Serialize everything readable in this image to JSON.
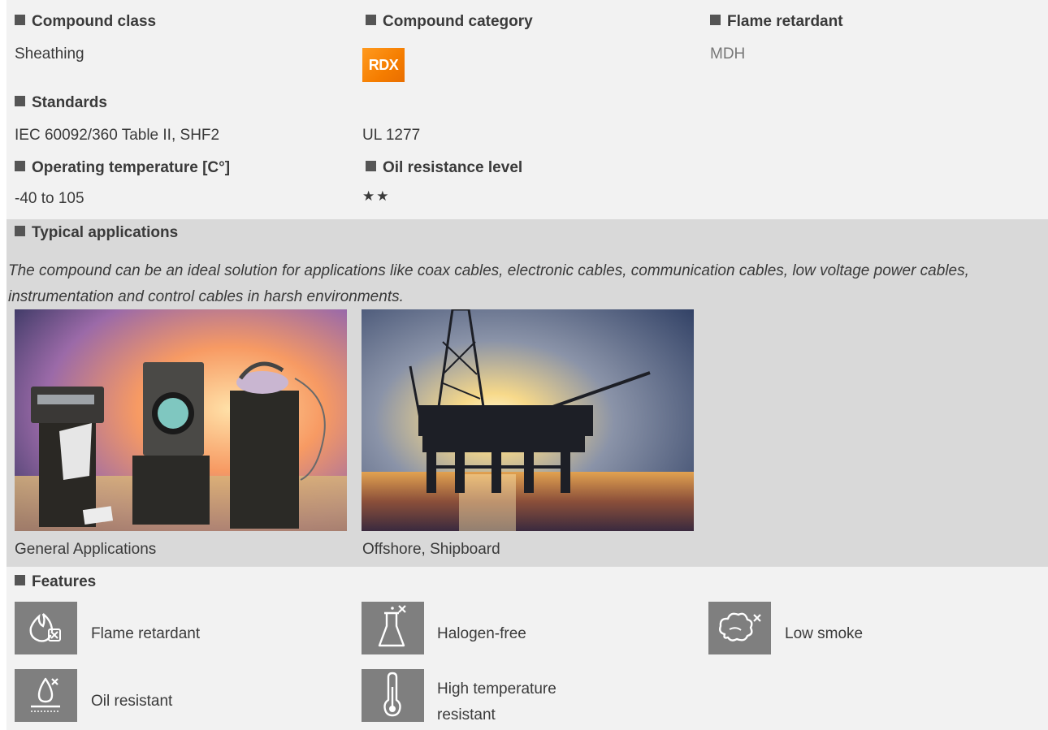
{
  "compound_class": {
    "heading": "Compound class",
    "value": "Sheathing"
  },
  "compound_category": {
    "heading": "Compound category",
    "badge": "RDX",
    "badge_color": "#f58a0a"
  },
  "flame_retardant": {
    "heading": "Flame retardant",
    "value": "MDH"
  },
  "standards": {
    "heading": "Standards",
    "values": [
      "IEC 60092/360 Table II, SHF2",
      "UL 1277"
    ]
  },
  "operating_temperature": {
    "heading": "Operating temperature [C°]",
    "value": "-40 to 105"
  },
  "oil_resistance": {
    "heading": "Oil resistance level",
    "value": "★★",
    "stars": 2
  },
  "typical_applications": {
    "heading": "Typical applications",
    "description": "The compound can be an ideal solution for applications like coax cables, electronic cables, communication cables, low voltage power cables, instrumentation and control cables in harsh environments.",
    "images": [
      {
        "caption": "General Applications",
        "icon": "appliances-image"
      },
      {
        "caption": "Offshore, Shipboard",
        "icon": "offshore-platform-image"
      }
    ]
  },
  "features": {
    "heading": "Features",
    "items": [
      {
        "label": "Flame retardant",
        "icon": "flame-retardant-icon"
      },
      {
        "label": "Halogen-free",
        "icon": "halogen-free-icon"
      },
      {
        "label": "Low smoke",
        "icon": "low-smoke-icon"
      },
      {
        "label": "Oil resistant",
        "icon": "oil-resistant-icon"
      },
      {
        "label": "High temperature resistant",
        "icon": "thermometer-icon"
      }
    ]
  },
  "colors": {
    "light_band": "#f2f2f2",
    "dark_band": "#d9d9d9",
    "icon_bg": "#7f7f7f"
  }
}
